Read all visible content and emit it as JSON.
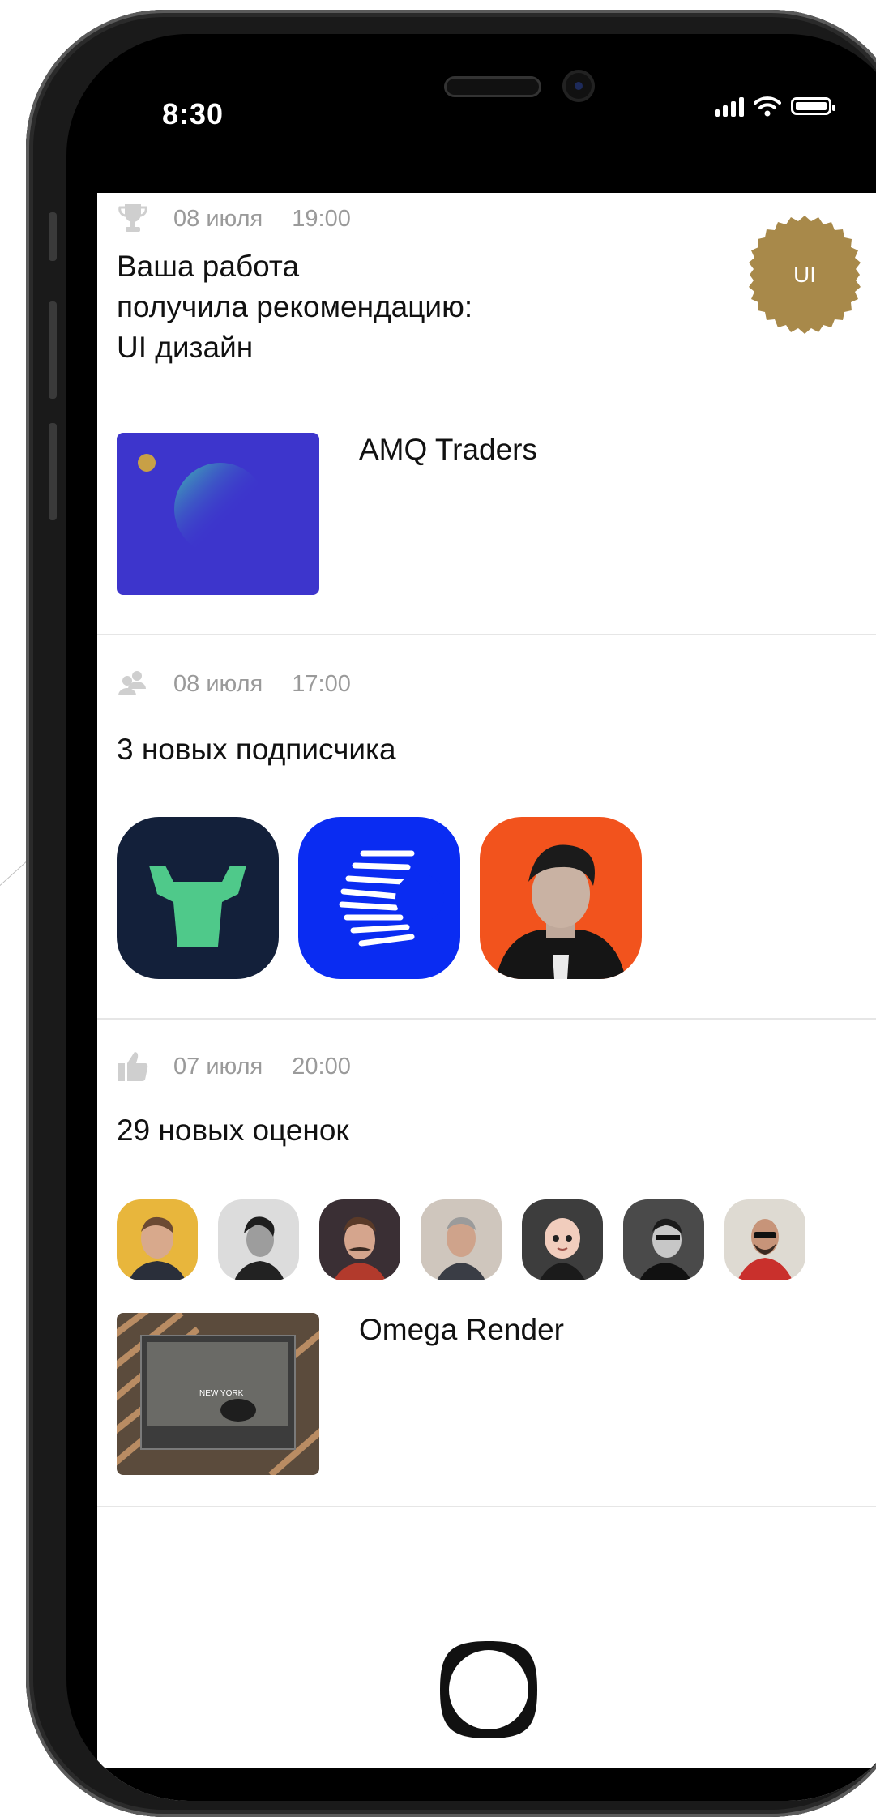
{
  "status_bar": {
    "time": "8:30"
  },
  "colors": {
    "accent_gold": "#a8894a",
    "text_dark": "#111111",
    "text_meta": "#9a9a9a",
    "divider": "#e6e6e6"
  },
  "notifications": [
    {
      "icon": "trophy-icon",
      "date": "08 июля",
      "time": "19:00",
      "title": "Ваша работа\nполучила рекомендацию:\nUI дизайн",
      "badge": "UI",
      "project": {
        "name": "AMQ Traders"
      }
    },
    {
      "icon": "followers-icon",
      "date": "08 июля",
      "time": "17:00",
      "title": "3 новых подписчика",
      "followers": [
        "bull-logo-avatar",
        "stripes-logo-avatar",
        "portrait-avatar"
      ]
    },
    {
      "icon": "thumbs-up-icon",
      "date": "07 июля",
      "time": "20:00",
      "title": "29 новых оценок",
      "raters_count_shown": 7,
      "project": {
        "name": "Omega Render",
        "thumb_text": "NEW YORK"
      }
    }
  ]
}
